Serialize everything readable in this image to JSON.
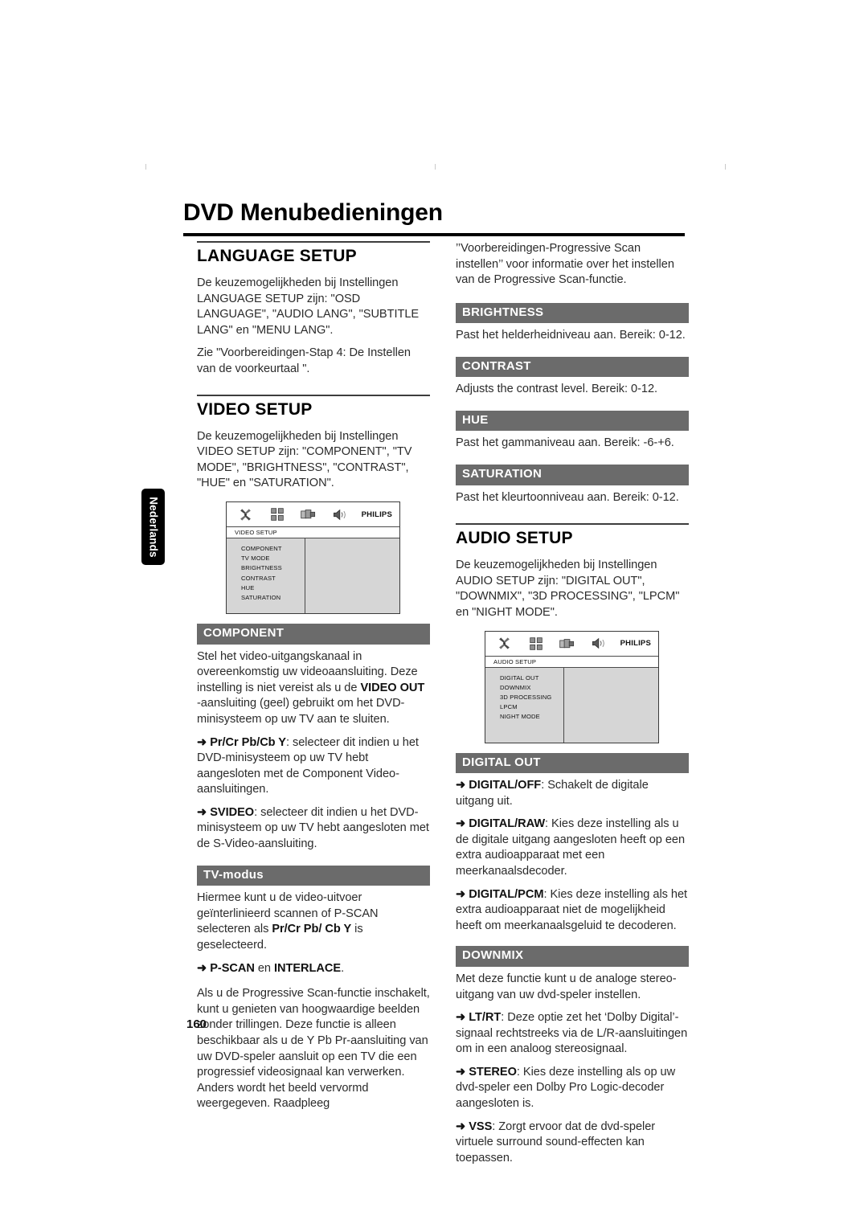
{
  "page": {
    "title": "DVD Menubedieningen",
    "side_tab": "Nederlands",
    "page_number": "160"
  },
  "left_column": {
    "language_setup": {
      "heading": "LANGUAGE SETUP",
      "paragraph1": "De keuzemogelijkheden bij Instellingen LANGUAGE SETUP zijn: \"OSD LANGUAGE\", \"AUDIO LANG\", \"SUBTITLE LANG\" en \"MENU LANG\".",
      "paragraph2": "Zie \"Voorbereidingen-Stap 4: De Instellen van de voorkeurtaal \"."
    },
    "video_setup": {
      "heading": "VIDEO SETUP",
      "paragraph1": "De keuzemogelijkheden bij Instellingen  VIDEO SETUP zijn: \"COMPONENT\", \"TV MODE\", \"BRIGHTNESS\", \"CONTRAST\", \"HUE\" en \"SATURATION\"."
    },
    "video_osd": {
      "caption": "VIDEO SETUP",
      "brand": "PHILIPS",
      "icons": [
        "tools-icon",
        "grid-squares-icon",
        "video-device-icon",
        "speaker-icon"
      ],
      "items": [
        "COMPONENT",
        "TV MODE",
        "BRIGHTNESS",
        "CONTRAST",
        "HUE",
        "SATURATION"
      ]
    },
    "component": {
      "bar": "COMPONENT",
      "p1_a": "Stel het video-uitgangskanaal in overeenkomstig uw videoaansluiting.  Deze instelling is niet vereist als u de ",
      "p1_b": "VIDEO OUT",
      "p1_c": " -aansluiting (geel) gebruikt om het DVD-minisysteem op uw TV aan te sluiten.",
      "p2_arrow": "➜",
      "p2_b": "Pr/Cr Pb/Cb Y",
      "p2_rest": ": selecteer dit indien u het DVD-minisysteem op uw TV hebt aangesloten met de Component Video-aansluitingen.",
      "p3_arrow": "➜",
      "p3_b": "SVIDEO",
      "p3_rest": ": selecteer dit indien u het DVD-minisysteem op uw TV hebt aangesloten met de S-Video-aansluiting."
    },
    "tv_modus": {
      "bar": "TV-modus",
      "p1_a": "Hiermee kunt u de video-uitvoer geïnterlinieerd scannen of P-SCAN selecteren als ",
      "p1_b": "Pr/Cr Pb/ Cb Y",
      "p1_c": " is geselecteerd.",
      "p2_arrow": "➜",
      "p2_b1": "P-SCAN",
      "p2_mid": " en ",
      "p2_b2": "INTERLACE",
      "p2_end": ".",
      "p3": "Als u de Progressive Scan-functie inschakelt, kunt u genieten van hoogwaardige beelden zonder trillingen. Deze functie is alleen beschikbaar als u de Y Pb Pr-aansluiting van uw DVD-speler aansluit op een TV die een progressief videosignaal kan verwerken. Anders wordt het beeld vervormd weergegeven. Raadpleeg"
    }
  },
  "right_column": {
    "continuation": "’’Voorbereidingen-Progressive Scan instellen’’ voor informatie over het instellen van de Progressive Scan-functie.",
    "brightness": {
      "bar": "BRIGHTNESS",
      "text": "Past het helderheidniveau aan. Bereik: 0-12."
    },
    "contrast": {
      "bar": "CONTRAST",
      "text": "Adjusts the contrast level. Bereik: 0-12."
    },
    "hue": {
      "bar": "HUE",
      "text": "Past het gammaniveau aan. Bereik: -6-+6."
    },
    "saturation": {
      "bar": "SATURATION",
      "text": "Past het kleurtoonniveau aan. Bereik: 0-12."
    },
    "audio_setup": {
      "heading": "AUDIO SETUP",
      "paragraph1": "De keuzemogelijkheden bij Instellingen AUDIO SETUP zijn: \"DIGITAL OUT\", \"DOWNMIX\", \"3D PROCESSING\", \"LPCM\" en \"NIGHT MODE\"."
    },
    "audio_osd": {
      "caption": "AUDIO SETUP",
      "brand": "PHILIPS",
      "icons": [
        "tools-icon",
        "grid-squares-icon",
        "video-device-icon",
        "speaker-icon"
      ],
      "items": [
        "DIGITAL OUT",
        "DOWNMIX",
        "3D PROCESSING",
        "LPCM",
        "NIGHT MODE"
      ]
    },
    "digital_out": {
      "bar": "DIGITAL OUT",
      "p1_arrow": "➜",
      "p1_b": "DIGITAL/OFF",
      "p1_rest": ": Schakelt de digitale uitgang uit.",
      "p2_arrow": "➜",
      "p2_b": "DIGITAL/RAW",
      "p2_rest": ":  Kies deze instelling als u de digitale uitgang aangesloten heeft op een extra audioapparaat met een meerkanaalsdecoder.",
      "p3_arrow": "➜",
      "p3_b": "DIGITAL/PCM",
      "p3_rest": ": Kies deze instelling als het extra audioapparaat niet de mogelijkheid heeft om meerkanaalsgeluid te decoderen."
    },
    "downmix": {
      "bar": "DOWNMIX",
      "p1": "Met deze functie kunt u de analoge stereo-uitgang van uw dvd-speler instellen.",
      "p2_arrow": "➜",
      "p2_b": "LT/RT",
      "p2_rest": ": Deze optie zet het ‘Dolby Digital’-signaal rechtstreeks via de L/R-aansluitingen om in een analoog stereosignaal.",
      "p3_arrow": "➜",
      "p3_b": "STEREO",
      "p3_rest": ": Kies deze instelling als op uw dvd-speler een Dolby Pro Logic-decoder aangesloten is.",
      "p4_arrow": "➜",
      "p4_b": "VSS",
      "p4_rest": ": Zorgt ervoor dat de dvd-speler virtuele surround sound-effecten kan toepassen."
    }
  }
}
